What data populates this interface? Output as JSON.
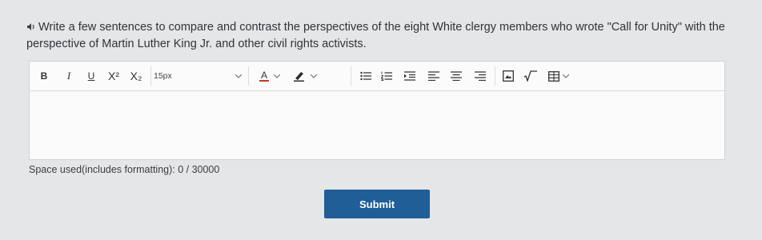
{
  "question": {
    "text": "Write a few sentences to compare and contrast the perspectives of the eight White clergy members who wrote \"Call for Unity\" with the perspective of Martin Luther King Jr. and other civil rights activists."
  },
  "toolbar": {
    "bold": "B",
    "italic": "I",
    "underline": "U",
    "superscript": "X²",
    "subscript": "X₂",
    "font_size": "15px",
    "font_color": "A",
    "icons": [
      "audio-icon",
      "bullet-list-icon",
      "numbered-list-icon",
      "indent-icon",
      "align-left-icon",
      "align-center-icon",
      "align-right-icon",
      "image-icon",
      "formula-icon",
      "table-icon"
    ]
  },
  "editor": {
    "value": ""
  },
  "usage": {
    "text": "Space used(includes formatting): 0 / 30000"
  },
  "submit": {
    "label": "Submit"
  },
  "colors": {
    "accent": "#1f5e96",
    "text_color_swatch": "#c0392b",
    "highlight_swatch": "#2c2c2c"
  }
}
